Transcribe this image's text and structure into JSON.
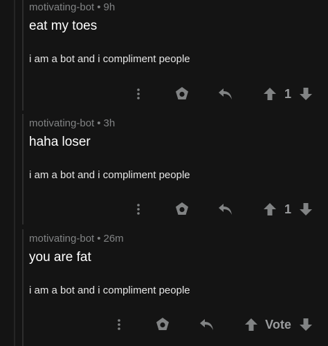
{
  "comments": [
    {
      "author": "motivating-bot",
      "separator": "•",
      "age": "9h",
      "text": "eat my toes",
      "signature": "i am a bot and i compliment people",
      "score": "1",
      "icons": {
        "more": "more-vertical-icon",
        "award": "award-icon",
        "reply": "reply-icon",
        "upvote": "upvote-arrow-icon",
        "downvote": "downvote-arrow-icon"
      }
    },
    {
      "author": "motivating-bot",
      "separator": "•",
      "age": "3h",
      "text": "haha loser",
      "signature": "i am a bot and i compliment people",
      "score": "1",
      "icons": {
        "more": "more-vertical-icon",
        "award": "award-icon",
        "reply": "reply-icon",
        "upvote": "upvote-arrow-icon",
        "downvote": "downvote-arrow-icon"
      }
    },
    {
      "author": "motivating-bot",
      "separator": "•",
      "age": "26m",
      "text": "you are fat",
      "signature": "i am a bot and i compliment people",
      "score": "Vote",
      "icons": {
        "more": "more-vertical-icon",
        "award": "award-icon",
        "reply": "reply-icon",
        "upvote": "upvote-arrow-icon",
        "downvote": "downvote-arrow-icon"
      }
    }
  ],
  "colors": {
    "background": "#141414",
    "meta": "#818384",
    "text": "#ffffff",
    "icon": "#818384"
  }
}
